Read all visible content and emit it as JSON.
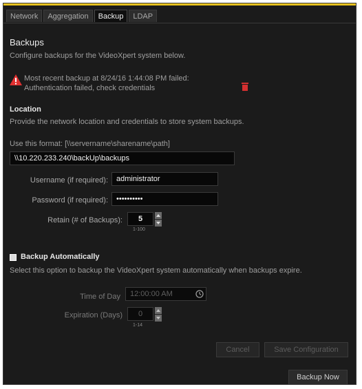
{
  "tabs": [
    {
      "label": "Network",
      "active": false
    },
    {
      "label": "Aggregation",
      "active": false
    },
    {
      "label": "Backup",
      "active": true
    },
    {
      "label": "LDAP",
      "active": false
    }
  ],
  "backups": {
    "title": "Backups",
    "description": "Configure backups for the VideoXpert system below.",
    "alert_line1": "Most recent backup at 8/24/16 1:44:08 PM failed:",
    "alert_line2": "Authentication failed, check credentials"
  },
  "location": {
    "title": "Location",
    "description": "Provide the network location and credentials to store system backups.",
    "format_hint": "Use this format: [\\\\servername\\sharename\\path]",
    "path_value": "\\\\10.220.233.240\\backUp\\backups",
    "username_label": "Username (if required):",
    "username_value": "administrator",
    "password_label": "Password (if required):",
    "password_value": "••••••••••",
    "retain_label": "Retain (# of Backups):",
    "retain_value": "5",
    "retain_range": "1-100"
  },
  "auto": {
    "checkbox_label": "Backup Automatically",
    "checked": false,
    "description": "Select this option to backup the VideoXpert system automatically when backups expire.",
    "time_label": "Time of Day",
    "time_value": "12:00:00 AM",
    "expiration_label": "Expiration (Days)",
    "expiration_value": "0",
    "expiration_range": "1-14"
  },
  "buttons": {
    "cancel": "Cancel",
    "save": "Save Configuration",
    "backup_now": "Backup Now"
  },
  "colors": {
    "accent": "#e7c21f",
    "warning": "#e03030",
    "panel": "#1b1b1b"
  }
}
